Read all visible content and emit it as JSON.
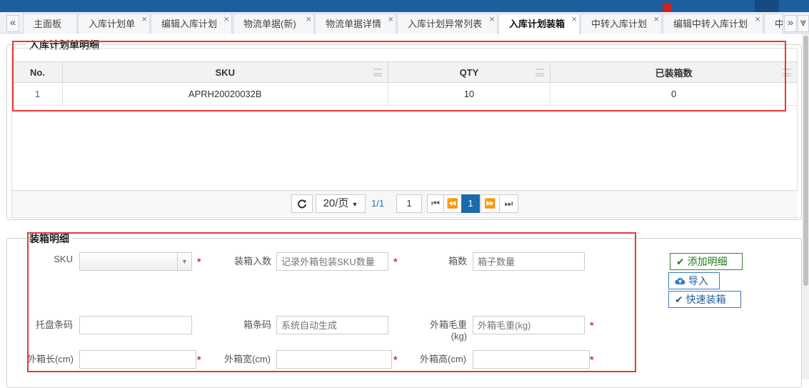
{
  "tabs": {
    "scroll_left": "«",
    "scroll_right": "»",
    "more": "⩔",
    "close_glyph": "×",
    "items": [
      {
        "label": "主面板",
        "closable": false
      },
      {
        "label": "入库计划单",
        "closable": true
      },
      {
        "label": "编辑入库计划",
        "closable": true
      },
      {
        "label": "物流单据(新)",
        "closable": true
      },
      {
        "label": "物流单据详情",
        "closable": true
      },
      {
        "label": "入库计划异常列表",
        "closable": true
      },
      {
        "label": "入库计划装箱",
        "closable": true,
        "active": true
      },
      {
        "label": "中转入库计划",
        "closable": true
      },
      {
        "label": "编辑中转入库计划",
        "closable": true
      },
      {
        "label": "中",
        "closable": false
      }
    ]
  },
  "plan_detail": {
    "legend": "入库计划单明细",
    "columns": [
      "No.",
      "SKU",
      "QTY",
      "已装箱数"
    ],
    "rows": [
      {
        "no": "1",
        "sku": "APRH20020032B",
        "qty": "10",
        "packed": "0"
      }
    ]
  },
  "pager": {
    "page_size": "20/页",
    "page_info": "1/1",
    "page_input": "1",
    "current_page": "1"
  },
  "packing": {
    "legend": "装箱明细",
    "fields": {
      "sku": {
        "label": "SKU",
        "value": ""
      },
      "qty_per_box": {
        "label": "装箱入数",
        "placeholder": "记录外箱包装SKU数量"
      },
      "box_count": {
        "label": "箱数",
        "placeholder": "箱子数量"
      },
      "pallet": {
        "label": "托盘条码",
        "placeholder": ""
      },
      "box_code": {
        "label": "箱条码",
        "placeholder": "系统自动生成"
      },
      "gross_weight": {
        "label": "外箱毛重",
        "label_unit": "(kg)",
        "placeholder": "外箱毛重(kg)"
      },
      "length": {
        "label": "外箱长(cm)",
        "placeholder": ""
      },
      "width": {
        "label": "外箱宽(cm)",
        "placeholder": ""
      },
      "height": {
        "label": "外箱高(cm)",
        "placeholder": ""
      }
    },
    "required_mark": "*",
    "buttons": {
      "add_detail": "添加明细",
      "import": "导入",
      "quick_pack": "快速装箱"
    }
  },
  "colors": {
    "accent": "#1b6aab",
    "highlight_box": "#e53935",
    "required": "#e32b2b",
    "add_button": "#1e7a1e"
  }
}
